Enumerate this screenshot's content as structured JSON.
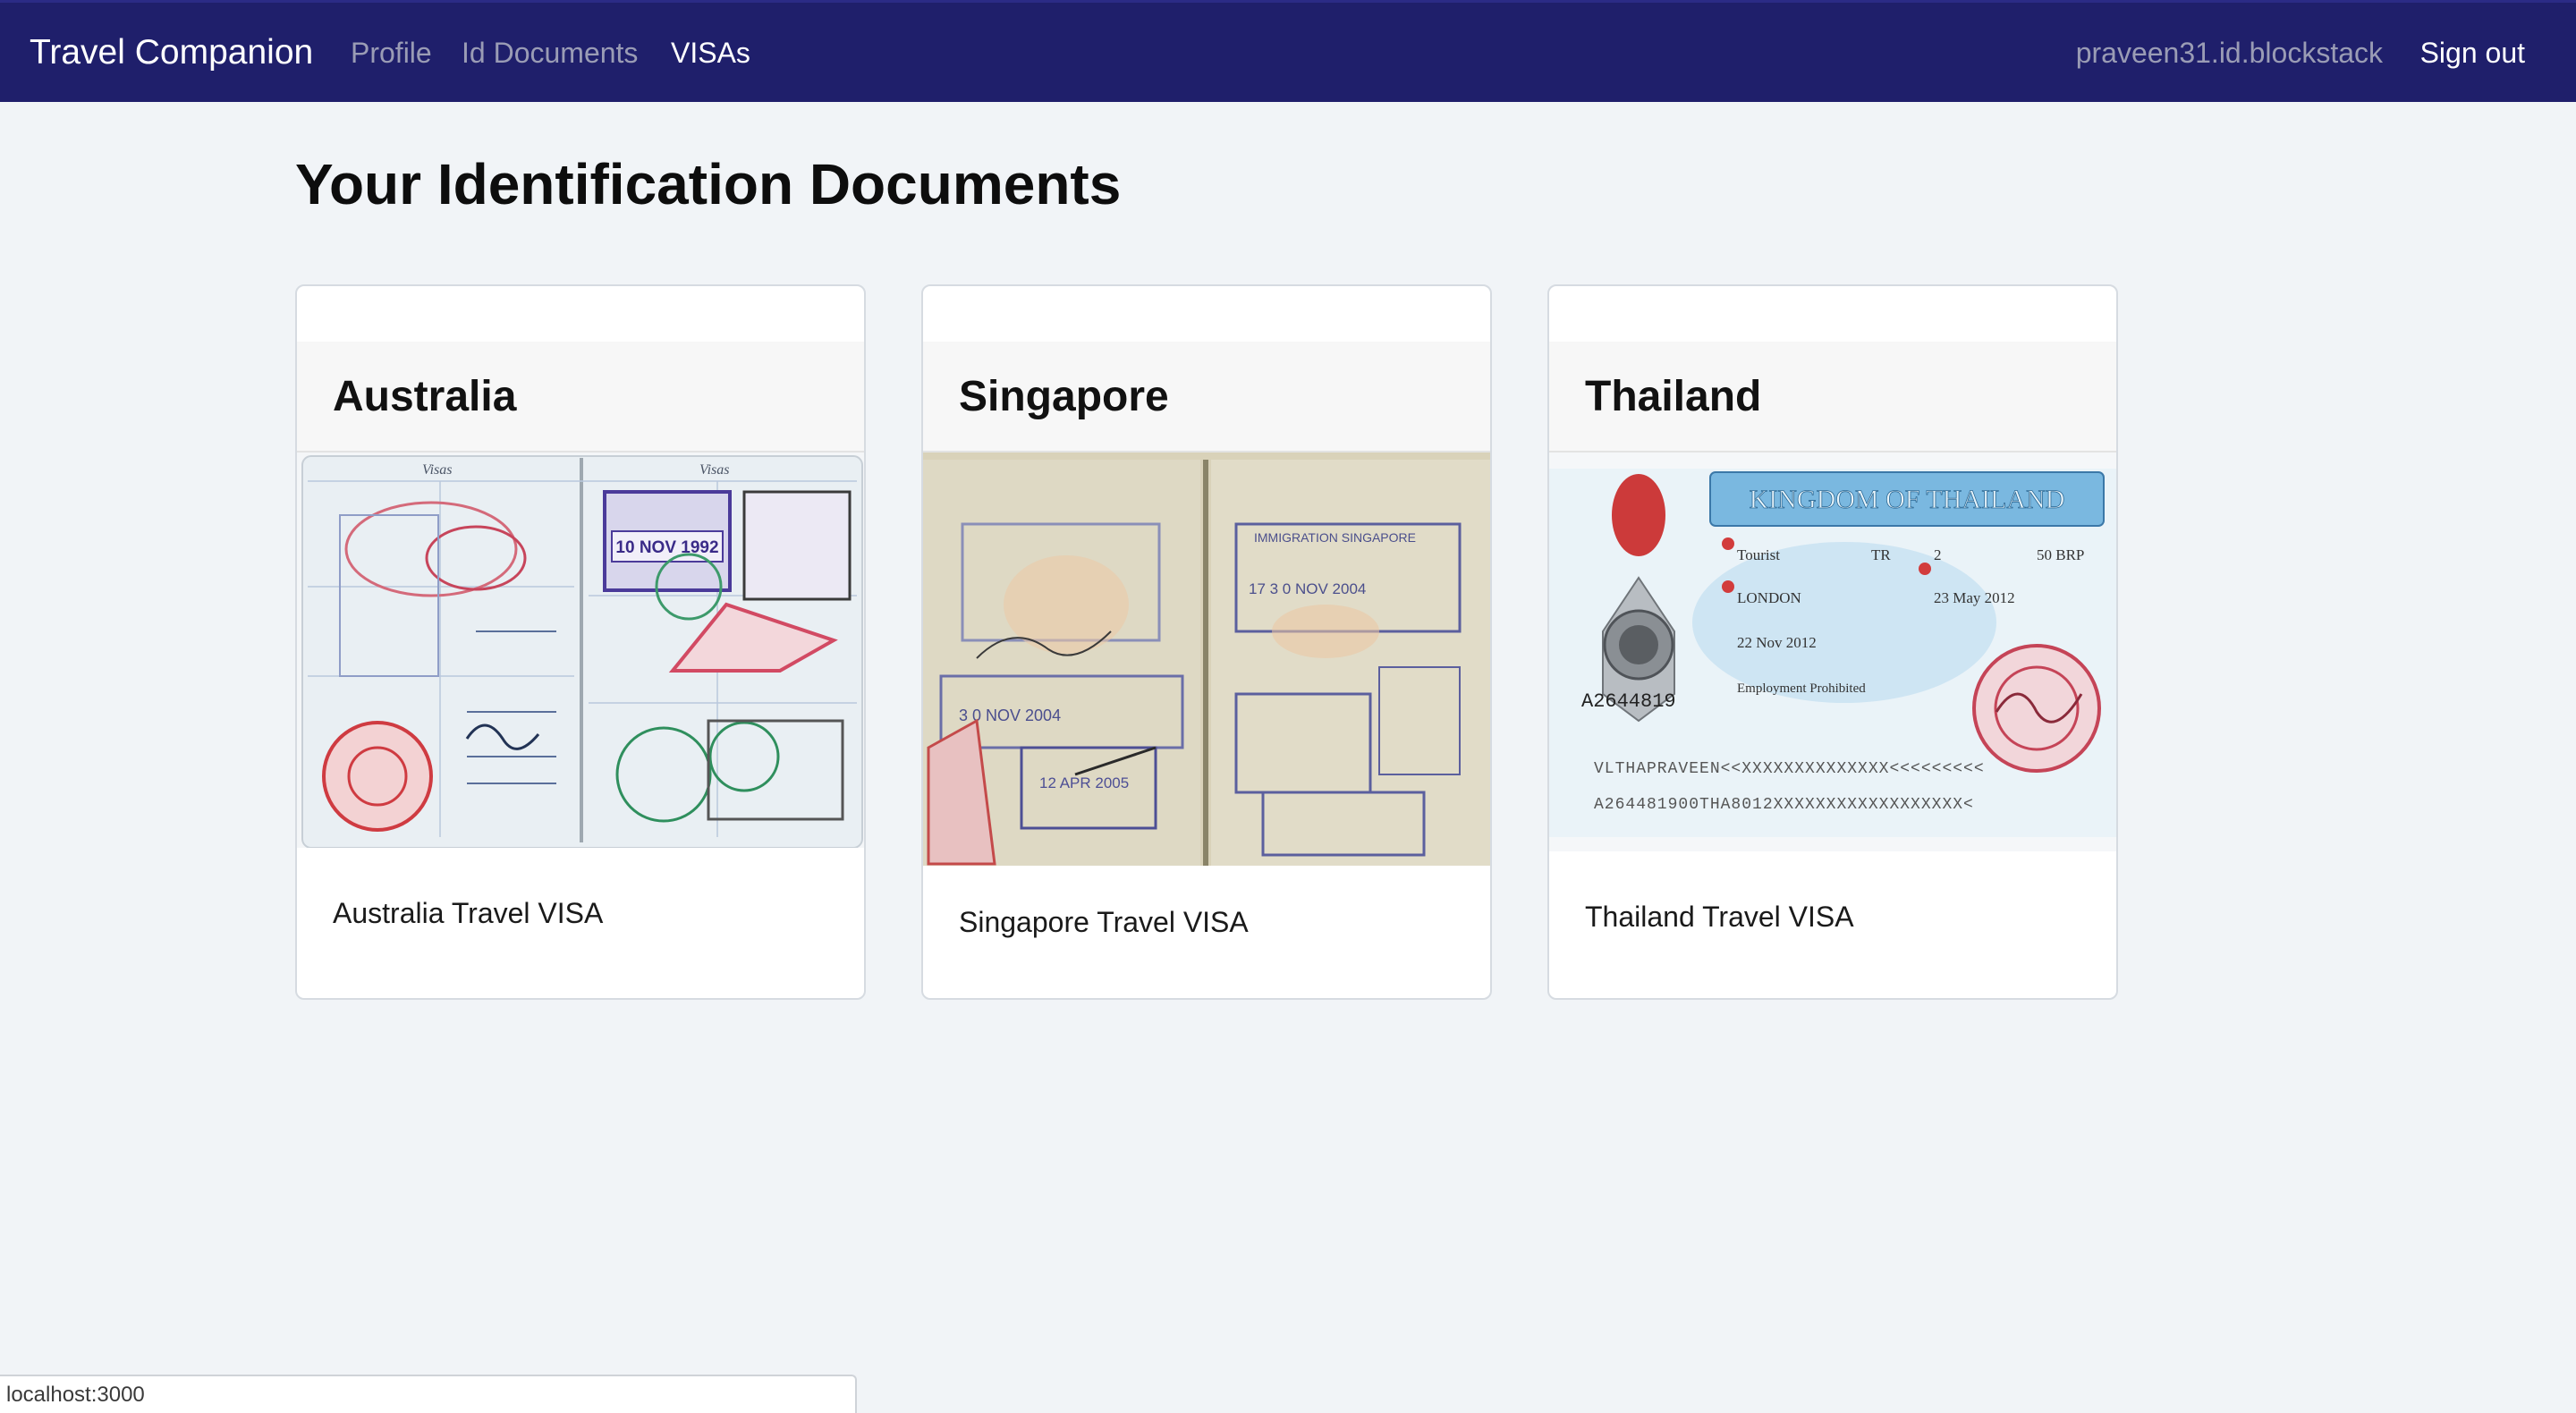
{
  "navbar": {
    "brand": "Travel Companion",
    "links": [
      {
        "label": "Profile"
      },
      {
        "label": "Id Documents"
      },
      {
        "label": "VISAs"
      }
    ],
    "user": "praveen31.id.blockstack",
    "signout_label": "Sign out",
    "background": "#1f1f6b"
  },
  "page": {
    "title": "Your Identification Documents"
  },
  "cards": [
    {
      "title": "Australia",
      "text": "Australia Travel VISA",
      "image": "passport-visa-stamps-image"
    },
    {
      "title": "Singapore",
      "text": "Singapore Travel VISA",
      "image": "passport-immigration-stamps-image"
    },
    {
      "title": "Thailand",
      "text": "Thailand Travel VISA",
      "image": "thailand-visa-sticker-image"
    }
  ],
  "thailand_visa": {
    "banner": "KINGDOM OF THAILAND",
    "visa_type": "Tourist",
    "category": "TR",
    "entries": "2",
    "fee": "50 BRP",
    "issued_at": "LONDON",
    "date_of_issue": "23 May 2012",
    "enter_before": "22 Nov 2012",
    "remarks": "Employment Prohibited",
    "number": "A2644819",
    "mrz_line_1": "VLTHAPRAVEEN<<XXXXXXXXXXXXXX<<<<<<<<<",
    "mrz_line_2": "A264481900THA8012XXXXXXXXXXXXXXXXXX<"
  },
  "australia_visa": {
    "stamp_date": "10 NOV 1992",
    "header_left": "Visas",
    "header_right": "Visas"
  },
  "singapore_visa": {
    "stamp_1": "3 0 NOV 2004",
    "stamp_2": "12 APR 2005",
    "stamp_3": "17 3 0 NOV 2004",
    "header": "IMMIGRATION SINGAPORE"
  },
  "status_bar": {
    "url": "localhost:3000"
  }
}
